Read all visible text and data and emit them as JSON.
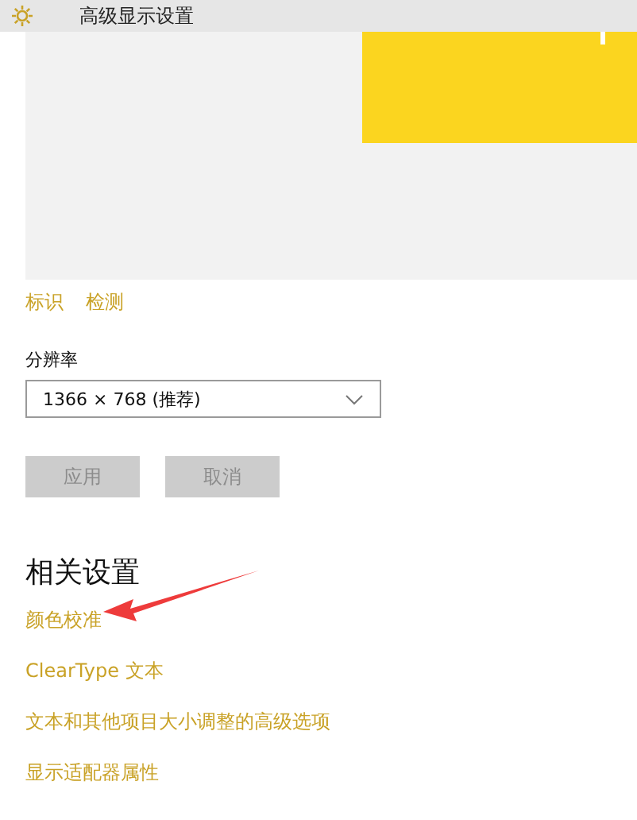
{
  "window": {
    "title": "高级显示设置"
  },
  "display_preview": {
    "links": [
      "标识",
      "检测"
    ]
  },
  "resolution": {
    "label": "分辨率",
    "value": "1366 × 768 (推荐)"
  },
  "buttons": [
    {
      "label": "应用",
      "disabled": true
    },
    {
      "label": "取消",
      "disabled": true
    }
  ],
  "related_settings": {
    "heading": "相关设置",
    "links": [
      "颜色校准",
      "ClearType 文本",
      "文本和其他项目大小调整的高级选项",
      "显示适配器属性"
    ]
  }
}
